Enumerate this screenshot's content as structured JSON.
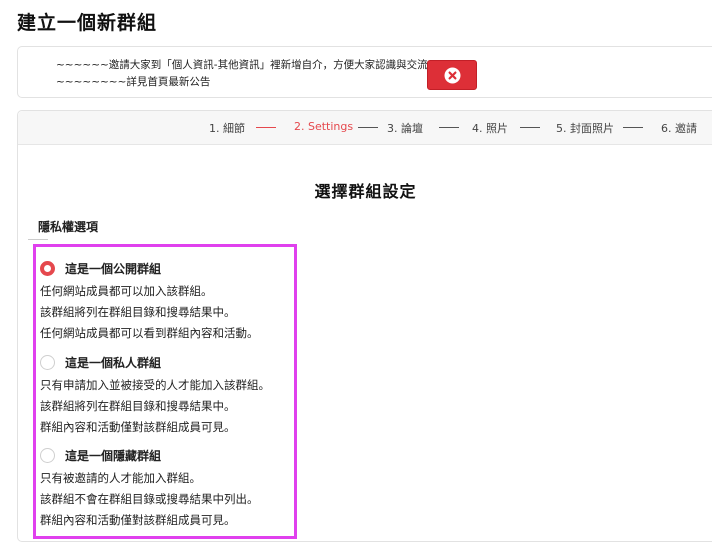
{
  "page": {
    "title": "建立一個新群組"
  },
  "notice": {
    "line1": "~~~~~~邀請大家到「個人資訊-其他資訊」裡新增自介，方便大家認識與交流",
    "line2": "~~~~~~~~詳見首頁最新公告",
    "close_icon": "close-circle-icon",
    "close_color": "#dd2f37"
  },
  "steps": [
    {
      "label": "1. 細節",
      "active": false
    },
    {
      "label": "2. Settings",
      "active": true
    },
    {
      "label": "3. 論壇",
      "active": false
    },
    {
      "label": "4. 照片",
      "active": false
    },
    {
      "label": "5. 封面照片",
      "active": false
    },
    {
      "label": "6. 邀請",
      "active": false
    }
  ],
  "section": {
    "title": "選擇群組設定"
  },
  "privacy": {
    "heading": "隱私權選項",
    "highlight_color": "#e040ee",
    "accent_color": "#e5484d",
    "options": [
      {
        "title": "這是一個公開群組",
        "selected": true,
        "lines": [
          "任何網站成員都可以加入該群組。",
          "該群組將列在群組目錄和搜尋結果中。",
          "任何網站成員都可以看到群組內容和活動。"
        ]
      },
      {
        "title": "這是一個私人群組",
        "selected": false,
        "lines": [
          "只有申請加入並被接受的人才能加入該群組。",
          "該群組將列在群組目錄和搜尋結果中。",
          "群組內容和活動僅對該群組成員可見。"
        ]
      },
      {
        "title": "這是一個隱藏群組",
        "selected": false,
        "lines": [
          "只有被邀請的人才能加入群組。",
          "該群組不會在群組目錄或搜尋結果中列出。",
          "群組內容和活動僅對該群組成員可見。"
        ]
      }
    ]
  }
}
